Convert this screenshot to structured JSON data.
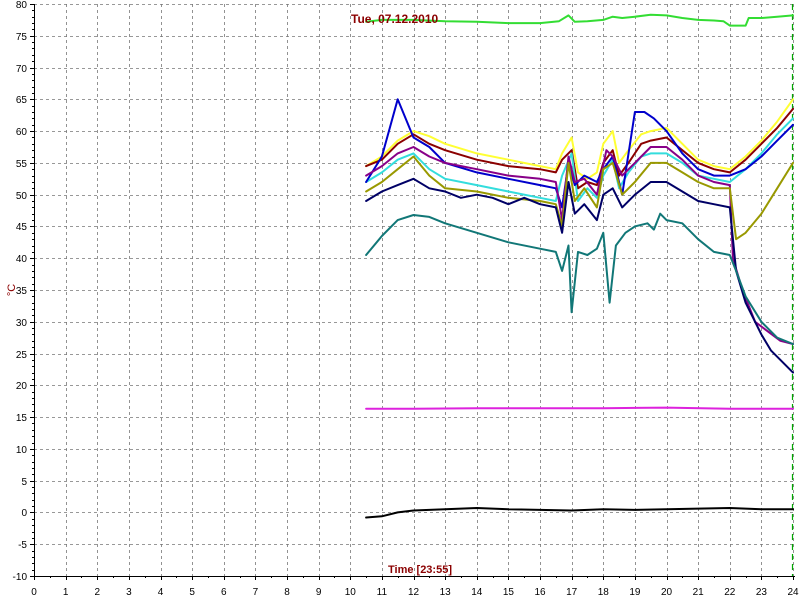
{
  "chart_data": {
    "type": "line",
    "title": "Tue, 07.12.2010",
    "xlabel": "Time [23:55]",
    "ylabel": "°C",
    "xlim": [
      0,
      24
    ],
    "ylim": [
      -10,
      80
    ],
    "x_ticks": [
      0,
      1,
      2,
      3,
      4,
      5,
      6,
      7,
      8,
      9,
      10,
      11,
      12,
      13,
      14,
      15,
      16,
      17,
      18,
      19,
      20,
      21,
      22,
      23,
      24
    ],
    "y_ticks": [
      -10,
      -5,
      0,
      5,
      10,
      15,
      20,
      25,
      30,
      35,
      40,
      45,
      50,
      55,
      60,
      65,
      70,
      75,
      80
    ],
    "y_tick_labels": [
      "-10",
      "-5",
      "0",
      "5",
      "10",
      "15",
      "20",
      "25",
      "30",
      "35",
      "40",
      "45",
      "50",
      "55",
      "60",
      "65",
      "70",
      "75",
      "80"
    ],
    "grid": true,
    "current_time_marker_x": 24,
    "series": [
      {
        "color": "#33dd33",
        "points": [
          [
            10.5,
            77.2
          ],
          [
            11,
            77.5
          ],
          [
            12,
            77.5
          ],
          [
            13,
            77.3
          ],
          [
            14,
            77.2
          ],
          [
            15,
            77.0
          ],
          [
            16,
            77.0
          ],
          [
            16.6,
            77.3
          ],
          [
            16.9,
            78.2
          ],
          [
            17.1,
            77.2
          ],
          [
            17.5,
            77.3
          ],
          [
            18.0,
            77.5
          ],
          [
            18.3,
            78.0
          ],
          [
            18.6,
            77.8
          ],
          [
            19,
            78.0
          ],
          [
            19.5,
            78.3
          ],
          [
            20,
            78.2
          ],
          [
            20.5,
            77.8
          ],
          [
            21,
            77.5
          ],
          [
            21.5,
            77.4
          ],
          [
            21.8,
            77.3
          ],
          [
            22,
            76.6
          ],
          [
            22.5,
            76.6
          ],
          [
            22.6,
            77.8
          ],
          [
            23,
            77.8
          ],
          [
            23.5,
            78.0
          ],
          [
            24,
            78.2
          ]
        ]
      },
      {
        "color": "#ffff33",
        "points": [
          [
            10.5,
            54.5
          ],
          [
            11,
            56.0
          ],
          [
            11.5,
            58.5
          ],
          [
            12,
            60.0
          ],
          [
            12.5,
            59.2
          ],
          [
            13,
            58.0
          ],
          [
            14,
            56.5
          ],
          [
            15,
            55.5
          ],
          [
            16,
            54.5
          ],
          [
            16.5,
            54.0
          ],
          [
            16.7,
            56.5
          ],
          [
            17.0,
            59.0
          ],
          [
            17.2,
            53.5
          ],
          [
            17.5,
            52.5
          ],
          [
            17.8,
            53.5
          ],
          [
            18.0,
            58.0
          ],
          [
            18.3,
            60.0
          ],
          [
            18.5,
            55.0
          ],
          [
            18.8,
            57.0
          ],
          [
            19.2,
            59.5
          ],
          [
            19.5,
            60.0
          ],
          [
            20,
            60.5
          ],
          [
            20.5,
            58.0
          ],
          [
            21,
            55.5
          ],
          [
            21.5,
            54.5
          ],
          [
            22,
            54.0
          ],
          [
            22.5,
            56.0
          ],
          [
            23,
            58.5
          ],
          [
            23.5,
            61.5
          ],
          [
            24,
            65.0
          ]
        ]
      },
      {
        "color": "#8b0000",
        "points": [
          [
            10.5,
            54.5
          ],
          [
            11,
            55.5
          ],
          [
            11.5,
            58.0
          ],
          [
            12,
            59.5
          ],
          [
            12.5,
            58.0
          ],
          [
            13,
            57.0
          ],
          [
            14,
            55.5
          ],
          [
            15,
            54.5
          ],
          [
            16,
            54.0
          ],
          [
            16.5,
            53.5
          ],
          [
            16.7,
            55.5
          ],
          [
            17.0,
            57.0
          ],
          [
            17.2,
            51.0
          ],
          [
            17.5,
            52.0
          ],
          [
            17.8,
            51.5
          ],
          [
            18.0,
            55.0
          ],
          [
            18.3,
            57.0
          ],
          [
            18.5,
            53.0
          ],
          [
            18.8,
            55.0
          ],
          [
            19.2,
            58.0
          ],
          [
            19.5,
            58.5
          ],
          [
            20,
            59.0
          ],
          [
            20.5,
            57.0
          ],
          [
            21,
            55.0
          ],
          [
            21.5,
            54.0
          ],
          [
            22,
            53.5
          ],
          [
            22.5,
            55.5
          ],
          [
            23,
            58.0
          ],
          [
            23.5,
            60.5
          ],
          [
            24,
            63.5
          ]
        ]
      },
      {
        "color": "#33dddd",
        "points": [
          [
            10.5,
            52.0
          ],
          [
            11,
            53.5
          ],
          [
            11.5,
            55.5
          ],
          [
            12,
            56.5
          ],
          [
            12.5,
            54.0
          ],
          [
            13,
            52.5
          ],
          [
            14,
            51.5
          ],
          [
            15,
            50.5
          ],
          [
            16,
            49.5
          ],
          [
            16.5,
            49.0
          ],
          [
            16.7,
            53.0
          ],
          [
            17.0,
            56.5
          ],
          [
            17.2,
            49.0
          ],
          [
            17.5,
            51.0
          ],
          [
            17.8,
            49.5
          ],
          [
            18.0,
            53.0
          ],
          [
            18.3,
            55.5
          ],
          [
            18.5,
            51.0
          ],
          [
            18.8,
            53.5
          ],
          [
            19.2,
            56.0
          ],
          [
            19.5,
            56.5
          ],
          [
            20,
            56.5
          ],
          [
            20.5,
            55.0
          ],
          [
            21,
            53.0
          ],
          [
            21.5,
            52.5
          ],
          [
            22,
            52.0
          ],
          [
            22.5,
            54.0
          ],
          [
            23,
            56.5
          ],
          [
            23.5,
            59.5
          ],
          [
            24,
            62.0
          ]
        ]
      },
      {
        "color": "#0000cc",
        "points": [
          [
            10.5,
            52.0
          ],
          [
            11,
            56.0
          ],
          [
            11.5,
            65.0
          ],
          [
            12,
            59.0
          ],
          [
            12.5,
            57.5
          ],
          [
            13,
            55.0
          ],
          [
            14,
            53.5
          ],
          [
            15,
            52.5
          ],
          [
            16,
            51.5
          ],
          [
            16.5,
            51.0
          ],
          [
            16.7,
            48.0
          ],
          [
            16.9,
            55.0
          ],
          [
            17.1,
            51.5
          ],
          [
            17.4,
            53.0
          ],
          [
            17.8,
            52.0
          ],
          [
            18.0,
            54.0
          ],
          [
            18.3,
            56.0
          ],
          [
            18.6,
            50.0
          ],
          [
            19.0,
            63.0
          ],
          [
            19.3,
            63.0
          ],
          [
            19.6,
            62.0
          ],
          [
            20,
            60.0
          ],
          [
            20.5,
            56.5
          ],
          [
            21,
            54.0
          ],
          [
            21.5,
            53.0
          ],
          [
            22,
            53.0
          ],
          [
            22.5,
            54.0
          ],
          [
            23,
            56.0
          ],
          [
            23.5,
            58.5
          ],
          [
            24,
            61.0
          ]
        ]
      },
      {
        "color": "#880088",
        "points": [
          [
            10.5,
            53.0
          ],
          [
            11,
            54.5
          ],
          [
            11.5,
            56.5
          ],
          [
            12,
            57.5
          ],
          [
            12.5,
            56.0
          ],
          [
            13,
            55.0
          ],
          [
            14,
            54.0
          ],
          [
            15,
            53.0
          ],
          [
            16,
            52.5
          ],
          [
            16.5,
            52.0
          ],
          [
            16.7,
            46.0
          ],
          [
            16.9,
            56.0
          ],
          [
            17.1,
            52.0
          ],
          [
            17.4,
            52.5
          ],
          [
            17.8,
            50.0
          ],
          [
            18.1,
            57.0
          ],
          [
            18.3,
            56.0
          ],
          [
            18.6,
            53.0
          ],
          [
            19.0,
            55.0
          ],
          [
            19.5,
            57.5
          ],
          [
            20,
            57.5
          ],
          [
            20.5,
            55.5
          ],
          [
            21,
            53.0
          ],
          [
            21.5,
            52.0
          ],
          [
            22,
            51.5
          ],
          [
            22.1,
            40.0
          ],
          [
            22.4,
            35.0
          ],
          [
            22.8,
            30.0
          ],
          [
            23.2,
            28.5
          ],
          [
            23.6,
            27.0
          ],
          [
            24,
            26.5
          ]
        ]
      },
      {
        "color": "#999900",
        "points": [
          [
            10.5,
            50.5
          ],
          [
            11,
            52.0
          ],
          [
            11.5,
            54.0
          ],
          [
            12,
            56.0
          ],
          [
            12.5,
            53.0
          ],
          [
            13,
            51.0
          ],
          [
            14,
            50.5
          ],
          [
            15,
            49.5
          ],
          [
            16,
            49.0
          ],
          [
            16.5,
            48.5
          ],
          [
            16.7,
            45.0
          ],
          [
            16.9,
            55.0
          ],
          [
            17.1,
            49.0
          ],
          [
            17.4,
            51.0
          ],
          [
            17.8,
            48.0
          ],
          [
            18.0,
            54.0
          ],
          [
            18.3,
            55.0
          ],
          [
            18.6,
            50.0
          ],
          [
            19.0,
            52.0
          ],
          [
            19.5,
            55.0
          ],
          [
            20,
            55.0
          ],
          [
            20.5,
            53.5
          ],
          [
            21,
            52.0
          ],
          [
            21.5,
            51.0
          ],
          [
            22,
            51.0
          ],
          [
            22.2,
            43.0
          ],
          [
            22.5,
            44.0
          ],
          [
            23,
            47.0
          ],
          [
            23.5,
            51.0
          ],
          [
            24,
            55.0
          ]
        ]
      },
      {
        "color": "#000066",
        "points": [
          [
            10.5,
            49.0
          ],
          [
            11,
            50.5
          ],
          [
            11.5,
            51.5
          ],
          [
            12,
            52.5
          ],
          [
            12.5,
            51.0
          ],
          [
            13,
            50.5
          ],
          [
            13.5,
            49.5
          ],
          [
            14,
            50.0
          ],
          [
            14.5,
            49.5
          ],
          [
            15,
            48.5
          ],
          [
            15.5,
            49.5
          ],
          [
            16,
            48.5
          ],
          [
            16.5,
            48.0
          ],
          [
            16.7,
            44.0
          ],
          [
            16.9,
            52.0
          ],
          [
            17.1,
            47.0
          ],
          [
            17.4,
            48.5
          ],
          [
            17.8,
            46.0
          ],
          [
            18.0,
            50.0
          ],
          [
            18.3,
            51.0
          ],
          [
            18.6,
            48.0
          ],
          [
            19.0,
            50.0
          ],
          [
            19.5,
            52.0
          ],
          [
            20,
            52.0
          ],
          [
            20.5,
            50.5
          ],
          [
            21,
            49.0
          ],
          [
            21.5,
            48.5
          ],
          [
            22,
            48.0
          ],
          [
            22.2,
            38.0
          ],
          [
            22.5,
            33.0
          ],
          [
            23,
            28.0
          ],
          [
            23.3,
            25.5
          ],
          [
            23.6,
            24.0
          ],
          [
            24,
            22.0
          ]
        ]
      },
      {
        "color": "#117777",
        "points": [
          [
            10.5,
            40.5
          ],
          [
            11,
            43.5
          ],
          [
            11.5,
            46.0
          ],
          [
            12,
            46.8
          ],
          [
            12.5,
            46.5
          ],
          [
            13,
            45.5
          ],
          [
            14,
            44.0
          ],
          [
            15,
            42.5
          ],
          [
            16,
            41.5
          ],
          [
            16.5,
            41.0
          ],
          [
            16.7,
            38.0
          ],
          [
            16.9,
            42.0
          ],
          [
            17.0,
            31.5
          ],
          [
            17.2,
            41.0
          ],
          [
            17.5,
            40.5
          ],
          [
            17.8,
            41.5
          ],
          [
            18.0,
            44.0
          ],
          [
            18.2,
            33.0
          ],
          [
            18.4,
            42.0
          ],
          [
            18.7,
            44.0
          ],
          [
            19,
            45.0
          ],
          [
            19.4,
            45.5
          ],
          [
            19.6,
            44.5
          ],
          [
            19.8,
            47.0
          ],
          [
            20,
            46.0
          ],
          [
            20.5,
            45.5
          ],
          [
            21,
            43.0
          ],
          [
            21.5,
            41.0
          ],
          [
            22,
            40.5
          ],
          [
            22.2,
            38.0
          ],
          [
            22.5,
            34.0
          ],
          [
            23,
            30.0
          ],
          [
            23.5,
            27.5
          ],
          [
            24,
            26.5
          ]
        ]
      },
      {
        "color": "#dd22dd",
        "points": [
          [
            10.5,
            16.3
          ],
          [
            12,
            16.3
          ],
          [
            14,
            16.4
          ],
          [
            16,
            16.4
          ],
          [
            18,
            16.4
          ],
          [
            20,
            16.5
          ],
          [
            22,
            16.3
          ],
          [
            24,
            16.3
          ]
        ]
      },
      {
        "color": "#000000",
        "points": [
          [
            10.5,
            -0.8
          ],
          [
            11,
            -0.6
          ],
          [
            11.5,
            0.0
          ],
          [
            12,
            0.3
          ],
          [
            13,
            0.5
          ],
          [
            14,
            0.7
          ],
          [
            15,
            0.5
          ],
          [
            16,
            0.4
          ],
          [
            17,
            0.3
          ],
          [
            18,
            0.5
          ],
          [
            19,
            0.4
          ],
          [
            20,
            0.5
          ],
          [
            21,
            0.6
          ],
          [
            22,
            0.7
          ],
          [
            23,
            0.5
          ],
          [
            24,
            0.5
          ]
        ]
      }
    ]
  }
}
